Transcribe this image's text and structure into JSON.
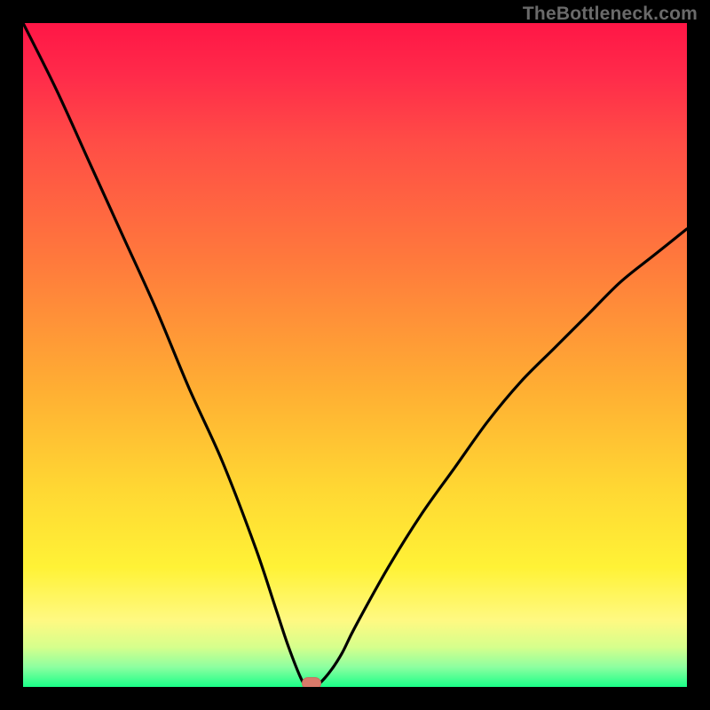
{
  "watermark": "TheBottleneck.com",
  "chart_data": {
    "type": "line",
    "title": "",
    "xlabel": "",
    "ylabel": "",
    "xlim": [
      0,
      100
    ],
    "ylim": [
      0,
      100
    ],
    "grid": false,
    "series": [
      {
        "name": "bottleneck-curve",
        "x": [
          0,
          5,
          10,
          15,
          20,
          25,
          30,
          35,
          38,
          40,
          42,
          43,
          44,
          46,
          48,
          50,
          55,
          60,
          65,
          70,
          75,
          80,
          85,
          90,
          95,
          100
        ],
        "y": [
          100,
          90,
          79,
          68,
          57,
          45,
          34,
          21,
          12,
          6,
          1,
          0,
          0,
          2,
          5,
          9,
          18,
          26,
          33,
          40,
          46,
          51,
          56,
          61,
          65,
          69
        ]
      }
    ],
    "minimum_marker": {
      "x": 43.5,
      "y": 0.5
    },
    "gradient_stops": [
      {
        "pct": 0,
        "color": "#ff1646"
      },
      {
        "pct": 36,
        "color": "#ff7a3c"
      },
      {
        "pct": 70,
        "color": "#ffd733"
      },
      {
        "pct": 90,
        "color": "#fff982"
      },
      {
        "pct": 100,
        "color": "#1aff88"
      }
    ]
  }
}
